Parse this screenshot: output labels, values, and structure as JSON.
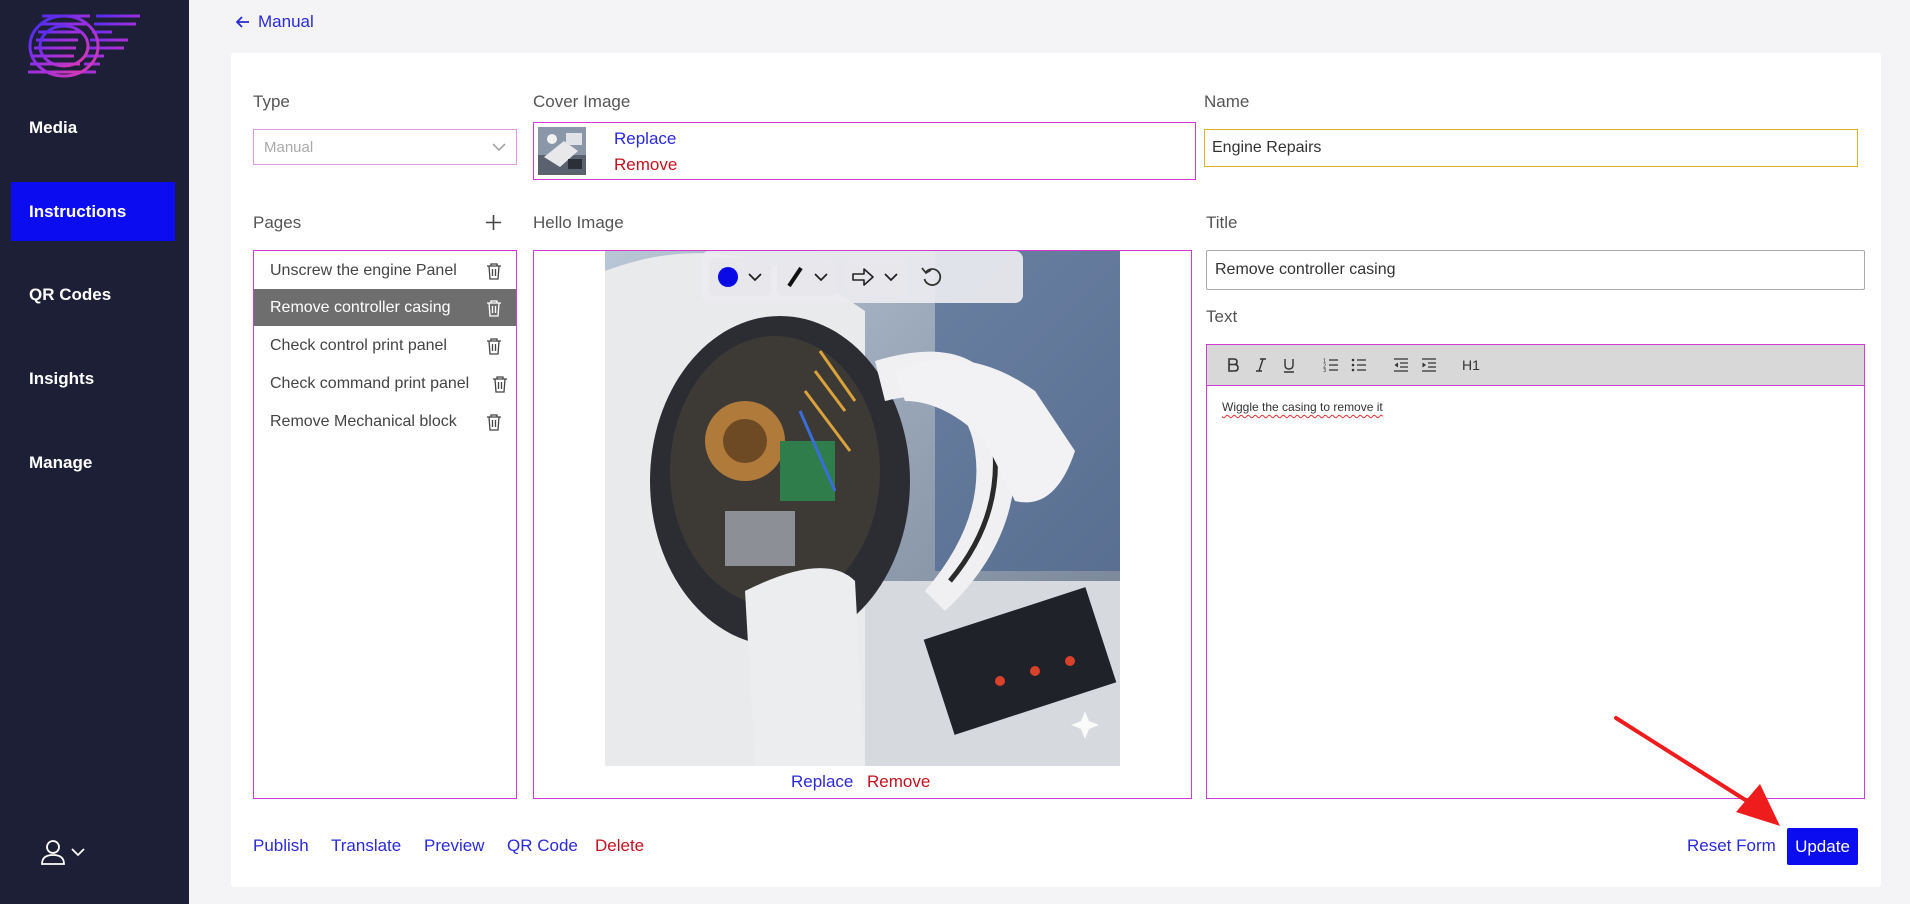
{
  "sidebar": {
    "items": [
      {
        "label": "Media"
      },
      {
        "label": "Instructions"
      },
      {
        "label": "QR Codes"
      },
      {
        "label": "Insights"
      },
      {
        "label": "Manage"
      }
    ],
    "active_color": "#0c0cf0"
  },
  "header": {
    "back_label": "Manual"
  },
  "form": {
    "type": {
      "label": "Type",
      "value": "Manual"
    },
    "cover": {
      "label": "Cover Image",
      "replace": "Replace",
      "remove": "Remove"
    },
    "name": {
      "label": "Name",
      "value": "Engine Repairs"
    },
    "pages": {
      "label": "Pages",
      "items": [
        {
          "label": "Unscrew the engine Panel"
        },
        {
          "label": "Remove controller casing"
        },
        {
          "label": "Check control print panel"
        },
        {
          "label": "Check command print panel"
        },
        {
          "label": "Remove Mechanical block"
        }
      ],
      "selected_index": 1
    },
    "hello_image": {
      "label": "Hello Image",
      "replace": "Replace",
      "remove": "Remove"
    },
    "title": {
      "label": "Title",
      "value": "Remove controller casing"
    },
    "text": {
      "label": "Text",
      "value": "Wiggle the casing to remove it",
      "heading_button": "H1"
    }
  },
  "actions": {
    "publish": "Publish",
    "translate": "Translate",
    "preview": "Preview",
    "qr_code": "QR Code",
    "delete": "Delete",
    "reset": "Reset Form",
    "update": "Update"
  },
  "colors": {
    "sidebar_bg": "#1c1f36",
    "link": "#2a2ad6",
    "danger": "#c1121f",
    "field_border": "#d23bd2",
    "name_border": "#e0b12a",
    "draw_color": "#0a0ae6"
  }
}
